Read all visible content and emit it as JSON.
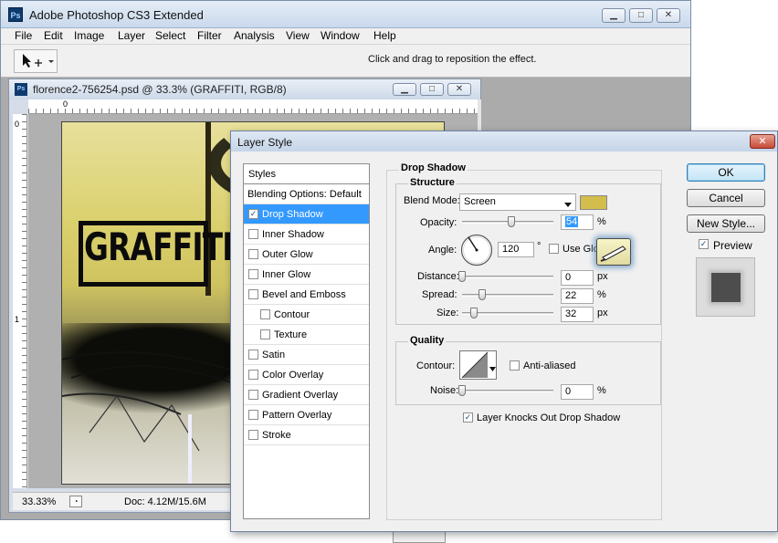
{
  "app": {
    "title": "Adobe Photoshop CS3 Extended",
    "logo": "Ps",
    "menu": [
      "File",
      "Edit",
      "Image",
      "Layer",
      "Select",
      "Filter",
      "Analysis",
      "View",
      "Window",
      "Help"
    ],
    "options_hint": "Click and drag to reposition the effect.",
    "tool_icon": "move-tool-icon"
  },
  "document": {
    "title": "florence2-756254.psd @ 33.3% (GRAFFITI, RGB/8)",
    "icon_text": "Ps",
    "ruler_top_zero": "0",
    "ruler_left_zero": "0",
    "ruler_left_one": "1",
    "artwork_text": "GRAFFITI",
    "zoom": "33.33%",
    "doc_info": "Doc: 4.12M/15.6M"
  },
  "dialog": {
    "title": "Layer Style",
    "styles_header": "Styles",
    "style_items": [
      {
        "label": "Blending Options: Default",
        "checkbox": false,
        "checked": false,
        "selected": false,
        "indent": false
      },
      {
        "label": "Drop Shadow",
        "checkbox": true,
        "checked": true,
        "selected": true,
        "indent": false
      },
      {
        "label": "Inner Shadow",
        "checkbox": true,
        "checked": false,
        "selected": false,
        "indent": false
      },
      {
        "label": "Outer Glow",
        "checkbox": true,
        "checked": false,
        "selected": false,
        "indent": false
      },
      {
        "label": "Inner Glow",
        "checkbox": true,
        "checked": false,
        "selected": false,
        "indent": false
      },
      {
        "label": "Bevel and Emboss",
        "checkbox": true,
        "checked": false,
        "selected": false,
        "indent": false
      },
      {
        "label": "Contour",
        "checkbox": true,
        "checked": false,
        "selected": false,
        "indent": true
      },
      {
        "label": "Texture",
        "checkbox": true,
        "checked": false,
        "selected": false,
        "indent": true
      },
      {
        "label": "Satin",
        "checkbox": true,
        "checked": false,
        "selected": false,
        "indent": false
      },
      {
        "label": "Color Overlay",
        "checkbox": true,
        "checked": false,
        "selected": false,
        "indent": false
      },
      {
        "label": "Gradient Overlay",
        "checkbox": true,
        "checked": false,
        "selected": false,
        "indent": false
      },
      {
        "label": "Pattern Overlay",
        "checkbox": true,
        "checked": false,
        "selected": false,
        "indent": false
      },
      {
        "label": "Stroke",
        "checkbox": true,
        "checked": false,
        "selected": false,
        "indent": false
      }
    ],
    "section_title": "Drop Shadow",
    "structure": {
      "title": "Structure",
      "blend_mode_label": "Blend Mode:",
      "blend_mode_value": "Screen",
      "shadow_color": "#d2bd4d",
      "opacity_label": "Opacity:",
      "opacity_value": "54",
      "opacity_unit": "%",
      "opacity_fraction": 0.54,
      "angle_label": "Angle:",
      "angle_value": "120",
      "angle_unit": "°",
      "use_global_light_label": "Use Global Light",
      "use_global_light_checked": false,
      "distance_label": "Distance:",
      "distance_value": "0",
      "distance_unit": "px",
      "distance_fraction": 0,
      "spread_label": "Spread:",
      "spread_value": "22",
      "spread_unit": "%",
      "spread_fraction": 0.22,
      "size_label": "Size:",
      "size_value": "32",
      "size_unit": "px",
      "size_fraction": 0.13
    },
    "quality": {
      "title": "Quality",
      "contour_label": "Contour:",
      "anti_aliased_label": "Anti-aliased",
      "anti_aliased_checked": false,
      "noise_label": "Noise:",
      "noise_value": "0",
      "noise_unit": "%",
      "noise_fraction": 0
    },
    "knockout_label": "Layer Knocks Out Drop Shadow",
    "knockout_checked": true,
    "buttons": {
      "ok": "OK",
      "cancel": "Cancel",
      "new_style": "New Style..."
    },
    "preview_label": "Preview",
    "preview_checked": true
  }
}
